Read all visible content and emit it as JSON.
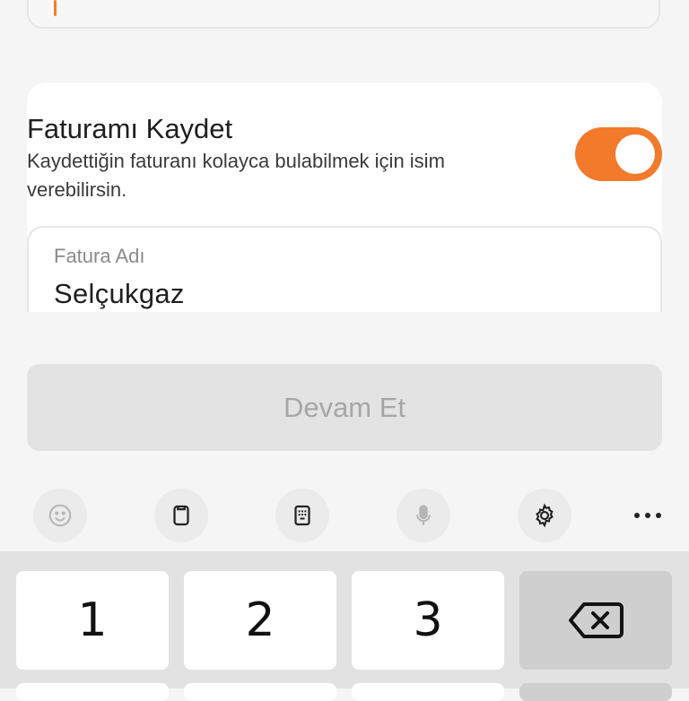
{
  "save_section": {
    "title": "Faturamı Kaydet",
    "subtitle": "Kaydettiğin faturanı kolayca bulabilmek için isim verebilirsin.",
    "toggle_on": true
  },
  "bill_name_field": {
    "label": "Fatura Adı",
    "value": "Selçukgaz"
  },
  "continue_button": {
    "label": "Devam Et",
    "enabled": false
  },
  "keyboard": {
    "toolbar": [
      "emoji-icon",
      "clipboard-icon",
      "keypad-icon",
      "microphone-icon",
      "settings-icon",
      "more-icon"
    ],
    "keys": [
      "1",
      "2",
      "3"
    ],
    "backspace_icon": "backspace-icon"
  },
  "colors": {
    "accent": "#f47a2b",
    "disabled_bg": "#e3e3e3",
    "disabled_text": "#a6a6a6"
  }
}
